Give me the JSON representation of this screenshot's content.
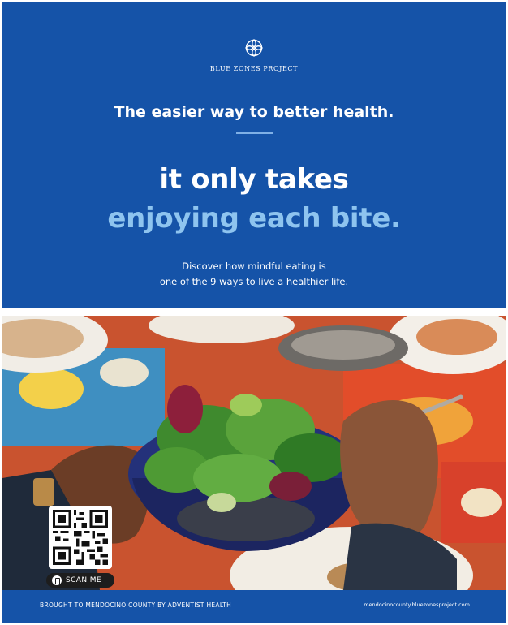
{
  "brand": {
    "logo_icon": "blue-zones-knot-icon",
    "name": "BLUE ZONES PROJECT"
  },
  "hero": {
    "tagline": "The easier way to better health.",
    "headline_line1": "it only takes",
    "headline_line2": "enjoying each bite.",
    "subtext_line1": "Discover how mindful eating is",
    "subtext_line2": "one of the 9 ways to live a healthier life."
  },
  "qr": {
    "label": "SCAN ME",
    "icon": "phone-icon"
  },
  "footer": {
    "left_text": "BROUGHT TO MENDOCINO COUNTY BY ADVENTIST HEALTH",
    "right_text": "mendocinocounty.bluezonesproject.com"
  },
  "colors": {
    "brand_blue": "#1553a8",
    "accent_light_blue": "#8ec4ef"
  }
}
